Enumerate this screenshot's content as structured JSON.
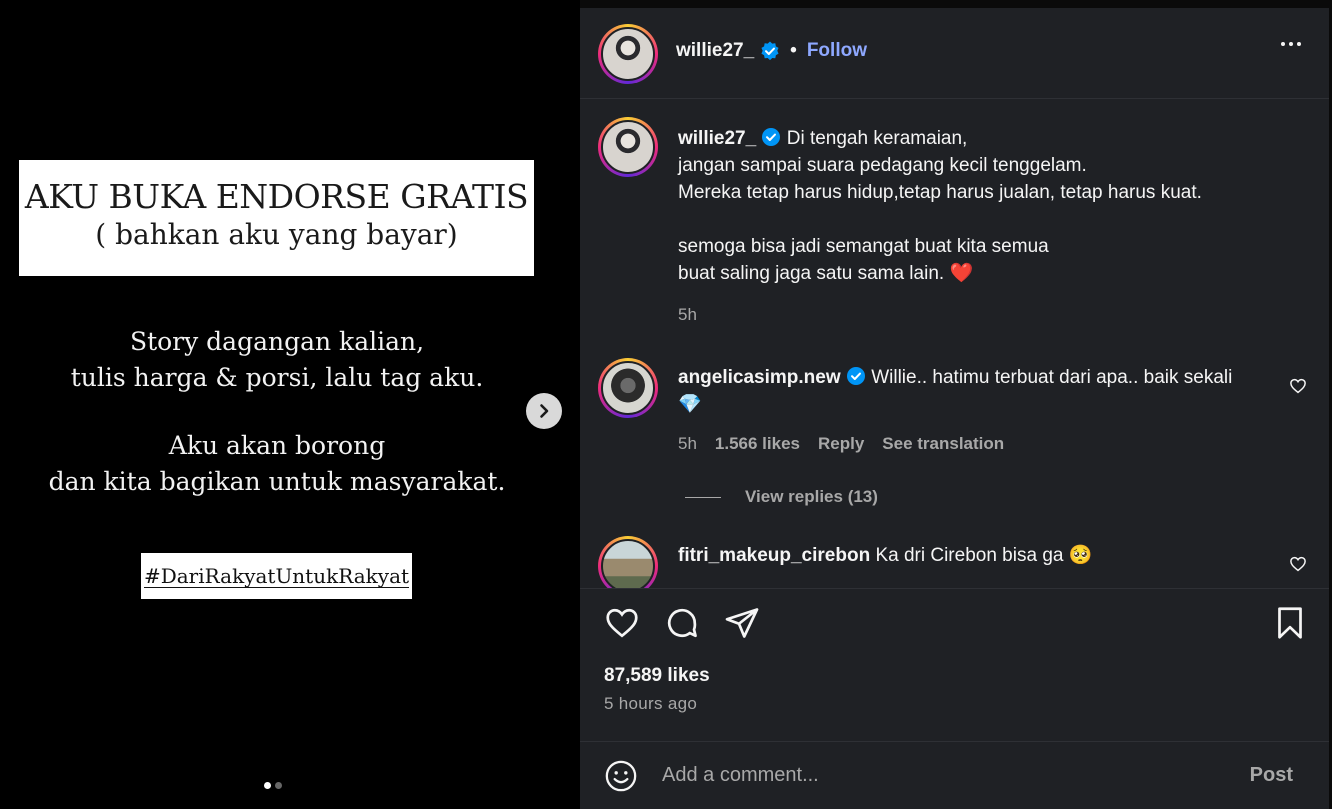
{
  "media": {
    "headline_line1": "AKU BUKA ENDORSE GRATIS",
    "headline_line2": "( bahkan aku yang bayar)",
    "text1_line1": "Story dagangan kalian,",
    "text1_line2": "tulis harga & porsi, lalu tag aku.",
    "text2_line1": "Aku akan borong",
    "text2_line2": "dan kita bagikan untuk masyarakat.",
    "hashtag": "#DariRakyatUntukRakyat",
    "carousel_count": 2,
    "carousel_active": 1
  },
  "header": {
    "username": "willie27_",
    "separator": "•",
    "follow_label": "Follow"
  },
  "caption": {
    "username": "willie27_",
    "line1": "Di tengah keramaian,",
    "line2": "jangan sampai suara pedagang kecil tenggelam.",
    "line3": "Mereka tetap harus hidup,tetap harus jualan, tetap harus kuat.",
    "line4": "semoga bisa jadi semangat buat kita semua",
    "line5": "buat saling jaga satu sama lain.",
    "emoji": "❤️",
    "time": "5h"
  },
  "comments": [
    {
      "username": "angelicasimp.new",
      "text": "Willie.. hatimu terbuat dari apa.. baik sekali",
      "emoji": "💎",
      "time": "5h",
      "likes": "1.566 likes",
      "reply": "Reply",
      "translate": "See translation",
      "view_replies": "View replies (13)"
    },
    {
      "username": "fitri_makeup_cirebon",
      "text": "Ka dri Cirebon bisa ga",
      "emoji": "🥺"
    }
  ],
  "likes": "87,589 likes",
  "time_ago": "5 hours ago",
  "comment_box": {
    "placeholder": "Add a comment...",
    "post_label": "Post"
  },
  "colors": {
    "panel_bg": "#1f2125",
    "accent": "#8ea8ff",
    "verified": "#0095f6",
    "muted": "#a8a8a8"
  }
}
